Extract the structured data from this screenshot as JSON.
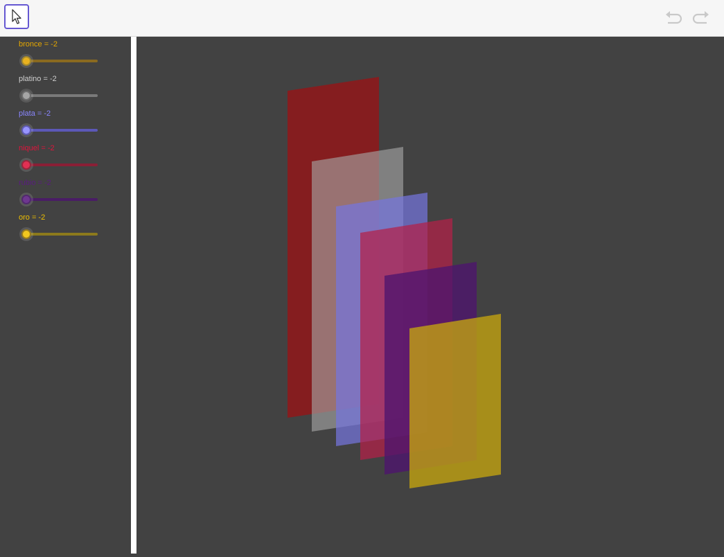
{
  "colors": {
    "bronce": "#e69a00",
    "platino": "#9a9a9a",
    "plata": "#7b7bff",
    "niquel": "#d41a3a",
    "rubio": "#4a1470",
    "oro": "#dcb400"
  },
  "toolbar": {
    "move_tool_icon": "cursor-arrow-icon",
    "undo_icon": "undo-icon",
    "redo_icon": "redo-icon"
  },
  "algebra": {
    "sliders": [
      {
        "label": "bronce = -2",
        "color": "#e6a800",
        "track": "#8a6a20"
      },
      {
        "label": "platino = -2",
        "color": "#d0d0d0",
        "track": "#7a7a7a"
      },
      {
        "label": "plata = -2",
        "color": "#8a86ff",
        "track": "#5c58b8"
      },
      {
        "label": "niquel = -2",
        "color": "#e0143c",
        "track": "#8a1f36"
      },
      {
        "label": "rubio = -2",
        "color": "#5a1c80",
        "track": "#4a1c66"
      },
      {
        "label": "oro = -2",
        "color": "#f0c000",
        "track": "#8c7a1c"
      }
    ]
  }
}
